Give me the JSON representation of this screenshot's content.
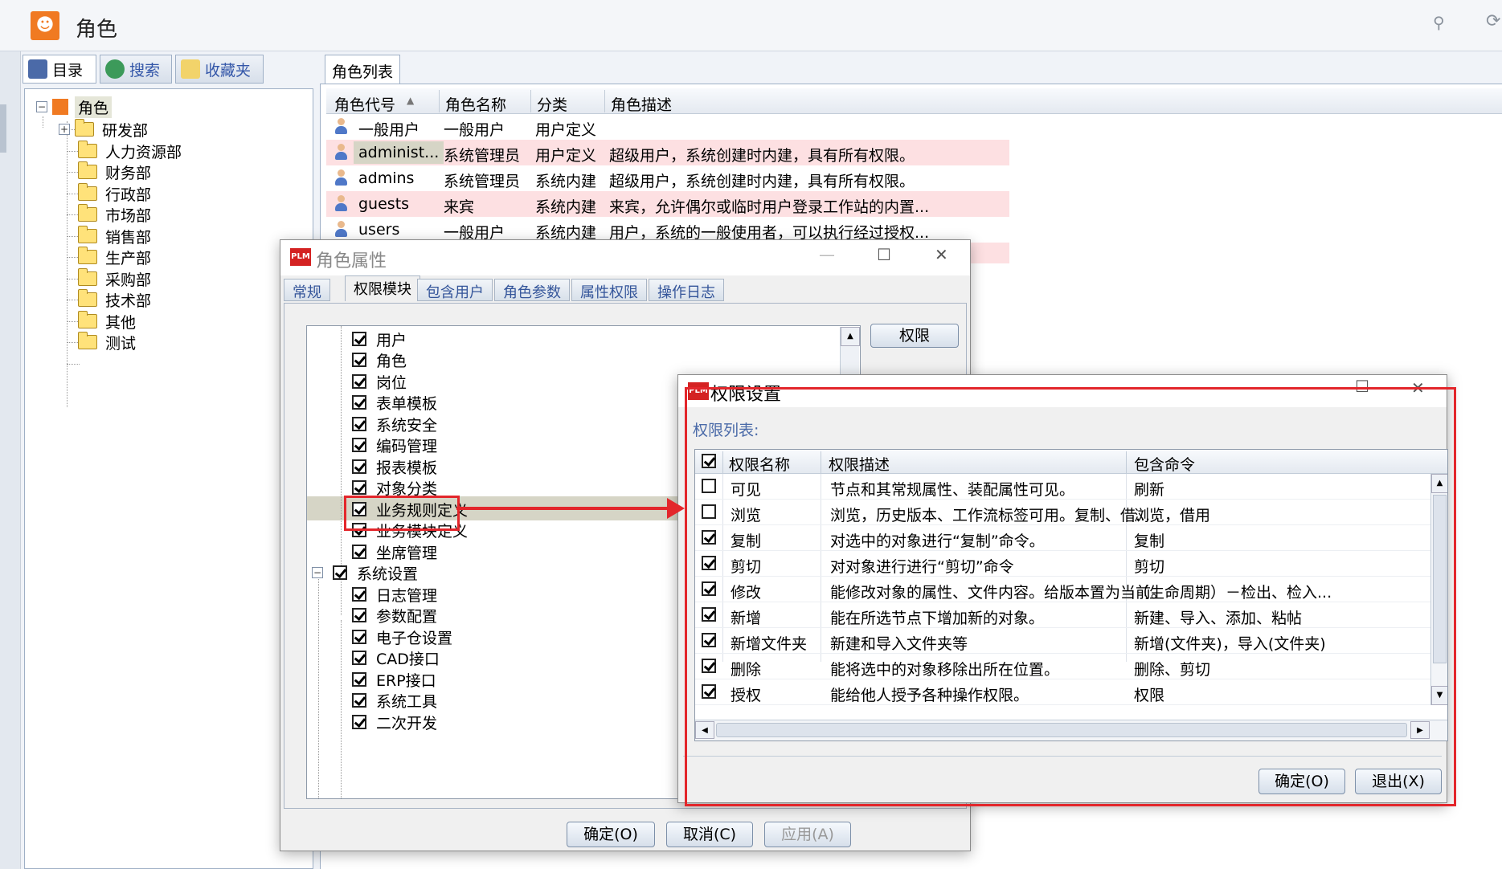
{
  "app": {
    "title": "角色"
  },
  "nav_tabs": [
    {
      "label": "目录"
    },
    {
      "label": "搜索"
    },
    {
      "label": "收藏夹"
    }
  ],
  "tree": {
    "root": "角色",
    "items": [
      "研发部",
      "人力资源部",
      "财务部",
      "行政部",
      "市场部",
      "销售部",
      "生产部",
      "采购部",
      "技术部",
      "其他",
      "测试"
    ]
  },
  "role_list": {
    "tab_label": "角色列表",
    "columns": [
      "角色代号",
      "角色名称",
      "分类",
      "角色描述"
    ],
    "rows": [
      {
        "code": "一般用户",
        "name": "一般用户",
        "category": "用户定义",
        "desc": ""
      },
      {
        "code": "administ...",
        "name": "系统管理员",
        "category": "用户定义",
        "desc": "超级用户，系统创建时内建，具有所有权限。"
      },
      {
        "code": "admins",
        "name": "系统管理员",
        "category": "系统内建",
        "desc": "超级用户，系统创建时内建，具有所有权限。"
      },
      {
        "code": "guests",
        "name": "来宾",
        "category": "系统内建",
        "desc": "来宾，允许偶尔或临时用户登录工作站的内置..."
      },
      {
        "code": "users",
        "name": "一般用户",
        "category": "系统内建",
        "desc": "用户，系统的一般使用者，可以执行经过授权..."
      }
    ]
  },
  "role_properties": {
    "title": "角色属性",
    "tabs": [
      "常规",
      "权限模块",
      "包含用户",
      "角色参数",
      "属性权限",
      "操作日志"
    ],
    "tree_items": [
      "用户",
      "角色",
      "岗位",
      "表单模板",
      "系统安全",
      "编码管理",
      "报表模板",
      "对象分类",
      "业务规则定义",
      "业务模块定义",
      "坐席管理"
    ],
    "group": "系统设置",
    "group_items": [
      "日志管理",
      "参数配置",
      "电子仓设置",
      "CAD接口",
      "ERP接口",
      "系统工具",
      "二次开发"
    ],
    "perm_button": "权限",
    "ok": "确定(O)",
    "cancel": "取消(C)",
    "apply": "应用(A)"
  },
  "permission_settings": {
    "title": "权限设置",
    "list_label": "权限列表:",
    "columns": [
      "权限名称",
      "权限描述",
      "包含命令"
    ],
    "rows": [
      {
        "checked": false,
        "name": "可见",
        "desc": "节点和其常规属性、装配属性可见。",
        "cmds": "刷新"
      },
      {
        "checked": false,
        "name": "浏览",
        "desc": "浏览，历史版本、工作流标签可用。复制、借...",
        "cmds": "浏览，借用"
      },
      {
        "checked": true,
        "name": "复制",
        "desc": "对选中的对象进行“复制”命令。",
        "cmds": "复制"
      },
      {
        "checked": true,
        "name": "剪切",
        "desc": "对对象进行进行“剪切”命令",
        "cmds": "剪切"
      },
      {
        "checked": true,
        "name": "修改",
        "desc": "能修改对象的属性、文件内容。给版本置为当前。",
        "cmds": "（生命周期）－检出、检入..."
      },
      {
        "checked": true,
        "name": "新增",
        "desc": "能在所选节点下增加新的对象。",
        "cmds": "新建、导入、添加、粘帖"
      },
      {
        "checked": true,
        "name": "新增文件夹",
        "desc": "新建和导入文件夹等",
        "cmds": "新增(文件夹)，导入(文件夹)"
      },
      {
        "checked": true,
        "name": "删除",
        "desc": "能将选中的对象移除出所在位置。",
        "cmds": "删除、剪切"
      },
      {
        "checked": true,
        "name": "授权",
        "desc": "能给他人授予各种操作权限。",
        "cmds": "权限"
      }
    ],
    "ok": "确定(O)",
    "exit": "退出(X)"
  },
  "icons": {
    "app": "role-icon",
    "plm": "PLM"
  },
  "colors": {
    "highlight_row": "#fde0e2",
    "annotation": "#e3262b",
    "selected_node": "#d6d5c6"
  }
}
